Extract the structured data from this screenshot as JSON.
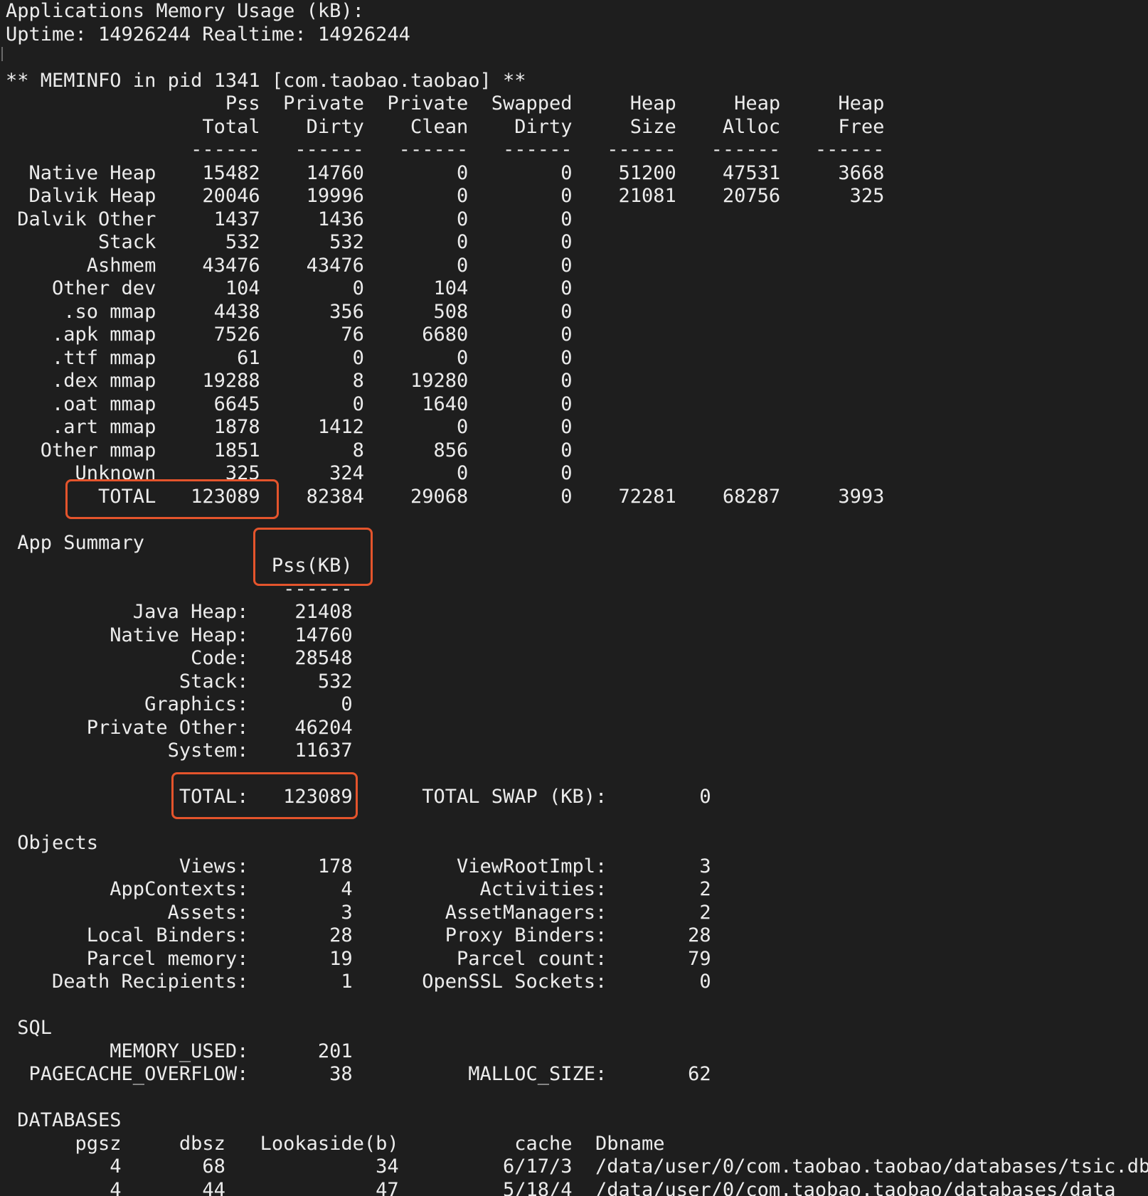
{
  "accent_color": "#e4542c",
  "terminal": {
    "lines": [
      "Applications Memory Usage (kB):",
      "Uptime: 14926244 Realtime: 14926244",
      "",
      "** MEMINFO in pid 1341 [com.taobao.taobao] **",
      "                   Pss  Private  Private  Swapped     Heap     Heap     Heap",
      "                 Total    Dirty    Clean    Dirty     Size    Alloc     Free",
      "                ------   ------   ------   ------   ------   ------   ------",
      "  Native Heap    15482    14760        0        0    51200    47531     3668",
      "  Dalvik Heap    20046    19996        0        0    21081    20756      325",
      " Dalvik Other     1437     1436        0        0",
      "        Stack      532      532        0        0",
      "       Ashmem    43476    43476        0        0",
      "    Other dev      104        0      104        0",
      "     .so mmap     4438      356      508        0",
      "    .apk mmap     7526       76     6680        0",
      "    .ttf mmap       61        0        0        0",
      "    .dex mmap    19288        8    19280        0",
      "    .oat mmap     6645        0     1640        0",
      "    .art mmap     1878     1412        0        0",
      "   Other mmap     1851        8      856        0",
      "      Unknown      325      324        0        0",
      "        TOTAL   123089    82384    29068        0    72281    68287     3993",
      "",
      " App Summary",
      "                       Pss(KB)",
      "                        ------",
      "           Java Heap:    21408",
      "         Native Heap:    14760",
      "                Code:    28548",
      "               Stack:      532",
      "            Graphics:        0",
      "       Private Other:    46204",
      "              System:    11637",
      "",
      "               TOTAL:   123089      TOTAL SWAP (KB):        0",
      "",
      " Objects",
      "               Views:      178         ViewRootImpl:        3",
      "         AppContexts:        4           Activities:        2",
      "              Assets:        3        AssetManagers:        2",
      "       Local Binders:       28        Proxy Binders:       28",
      "       Parcel memory:       19         Parcel count:       79",
      "    Death Recipients:        1      OpenSSL Sockets:        0",
      "",
      " SQL",
      "         MEMORY_USED:      201",
      "  PAGECACHE_OVERFLOW:       38          MALLOC_SIZE:       62",
      "",
      " DATABASES",
      "      pgsz     dbsz   Lookaside(b)          cache  Dbname",
      "         4       68             34         6/17/3  /data/user/0/com.taobao.taobao/databases/tsic.db",
      "         4       44             47         5/18/4  /data/user/0/com.taobao.taobao/databases/data"
    ]
  }
}
